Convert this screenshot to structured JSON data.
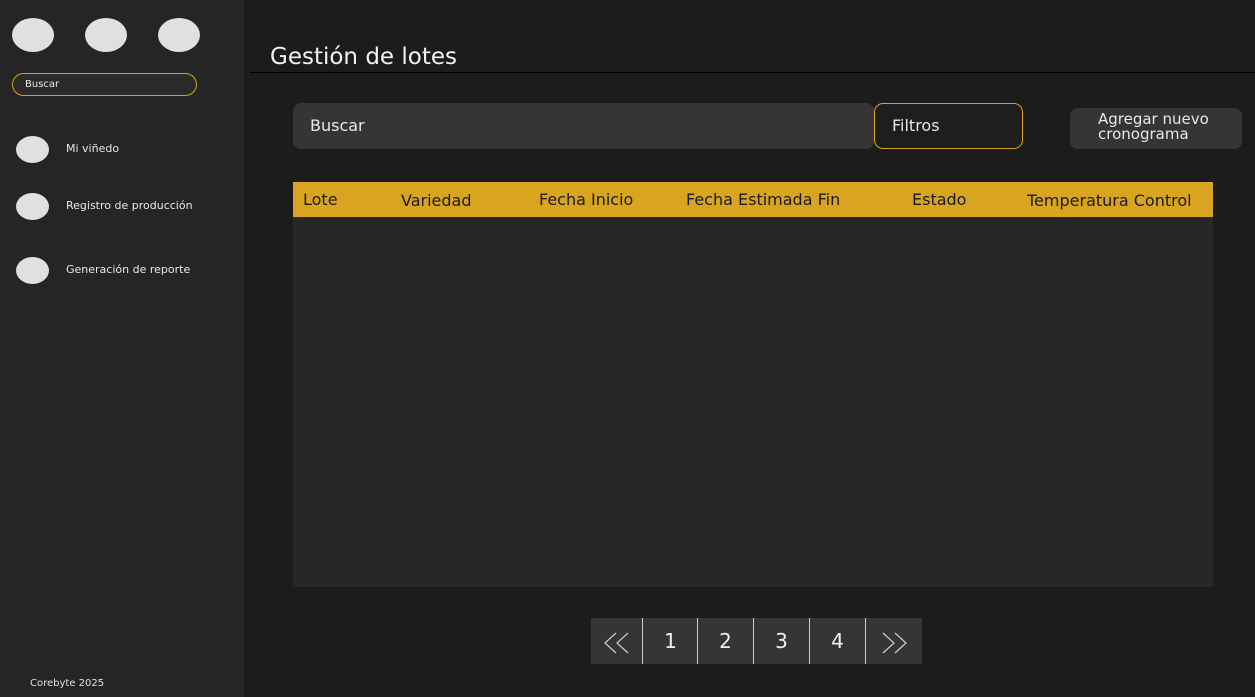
{
  "sidebar": {
    "search_placeholder": "Buscar",
    "items": [
      {
        "label": "Mi viñedo"
      },
      {
        "label": "Registro de producción"
      },
      {
        "label": "Generación de reporte"
      }
    ],
    "footer": "Corebyte 2025"
  },
  "main": {
    "title": "Gestión de lotes",
    "search_placeholder": "Buscar",
    "filters_label": "Filtros",
    "add_button_label": "Agregar nuevo\ncronograma"
  },
  "table": {
    "columns": [
      "Lote",
      "Variedad",
      "Fecha Inicio",
      "Fecha Estimada Fin",
      "Estado",
      "Temperatura Control"
    ],
    "rows": []
  },
  "pagination": {
    "first_symbol": "«",
    "pages": [
      "1",
      "2",
      "3",
      "4"
    ],
    "last_symbol": "»"
  },
  "colors": {
    "accent": "#d9a520",
    "background": "#1c1c1c",
    "sidebar": "#252525"
  }
}
